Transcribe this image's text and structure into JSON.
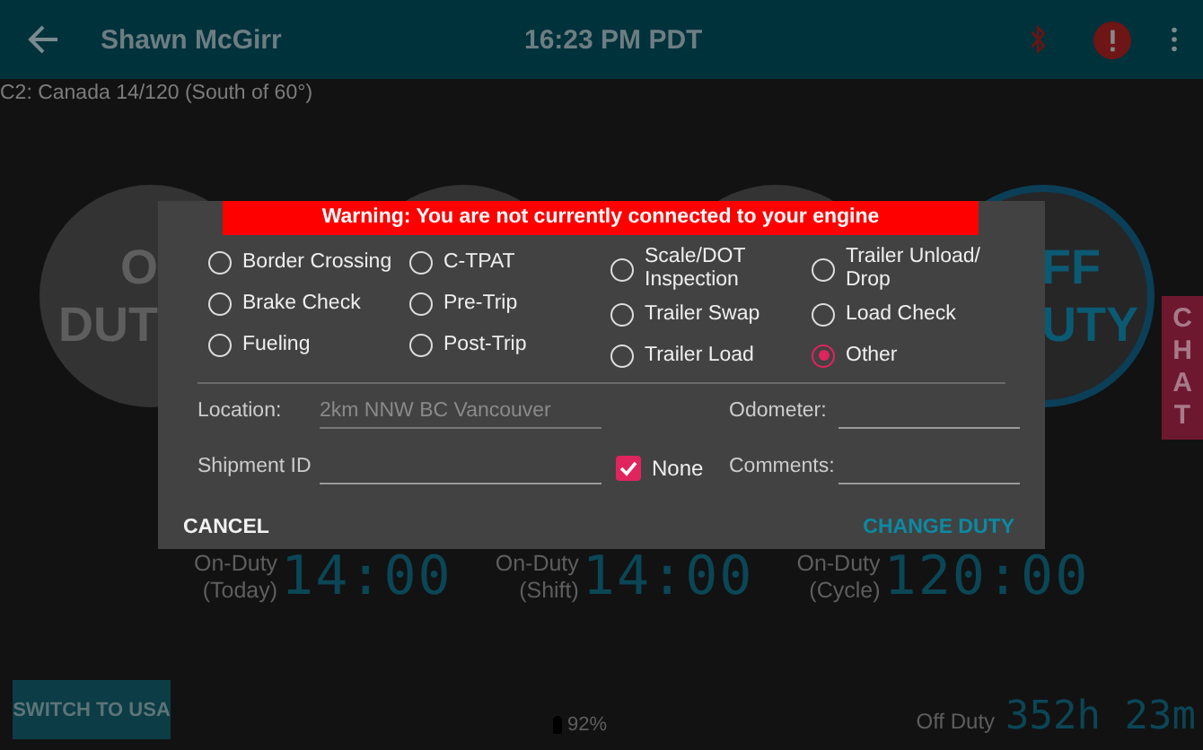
{
  "header": {
    "title": "Shawn McGirr",
    "time": "16:23 PM PDT"
  },
  "ruleset": "C2: Canada 14/120 (South of 60°)",
  "duty_buttons": [
    {
      "lines": [
        "O",
        "DUT"
      ],
      "selected": false
    },
    {
      "selected": false
    },
    {
      "selected": false
    },
    {
      "lines": [
        "FF",
        "UTY"
      ],
      "selected": true
    }
  ],
  "chat_tab": "CHAT",
  "dialog": {
    "warning": "Warning: You are not currently connected to your engine",
    "reason_columns": [
      [
        {
          "label": "Border Crossing",
          "selected": false
        },
        {
          "label": "Brake Check",
          "selected": false
        },
        {
          "label": "Fueling",
          "selected": false
        }
      ],
      [
        {
          "label": "C-TPAT",
          "selected": false
        },
        {
          "label": "Pre-Trip",
          "selected": false
        },
        {
          "label": "Post-Trip",
          "selected": false
        }
      ],
      [
        {
          "label": "Scale/DOT Inspection",
          "selected": false
        },
        {
          "label": "Trailer Swap",
          "selected": false
        },
        {
          "label": "Trailer Load",
          "selected": false
        }
      ],
      [
        {
          "label": "Trailer Unload/ Drop",
          "selected": false
        },
        {
          "label": "Load Check",
          "selected": false
        },
        {
          "label": "Other",
          "selected": true
        }
      ]
    ],
    "location": {
      "label": "Location:",
      "value": "2km NNW BC Vancouver",
      "disabled": true
    },
    "shipment": {
      "label": "Shipment ID"
    },
    "none_checkbox": {
      "label": "None",
      "checked": true
    },
    "odometer": {
      "label": "Odometer:"
    },
    "comments": {
      "label": "Comments:"
    },
    "cancel": "CANCEL",
    "confirm": "CHANGE DUTY"
  },
  "stats": [
    {
      "label": "On-Duty\n(Today)",
      "value": "14:00"
    },
    {
      "label": "On-Duty\n(Shift)",
      "value": "14:00"
    },
    {
      "label": "On-Duty\n(Cycle)",
      "value": "120:00"
    }
  ],
  "switch_button": "SWITCH TO USA",
  "battery": "92%",
  "off_duty": {
    "label": "Off Duty",
    "value": "352h 23m"
  }
}
